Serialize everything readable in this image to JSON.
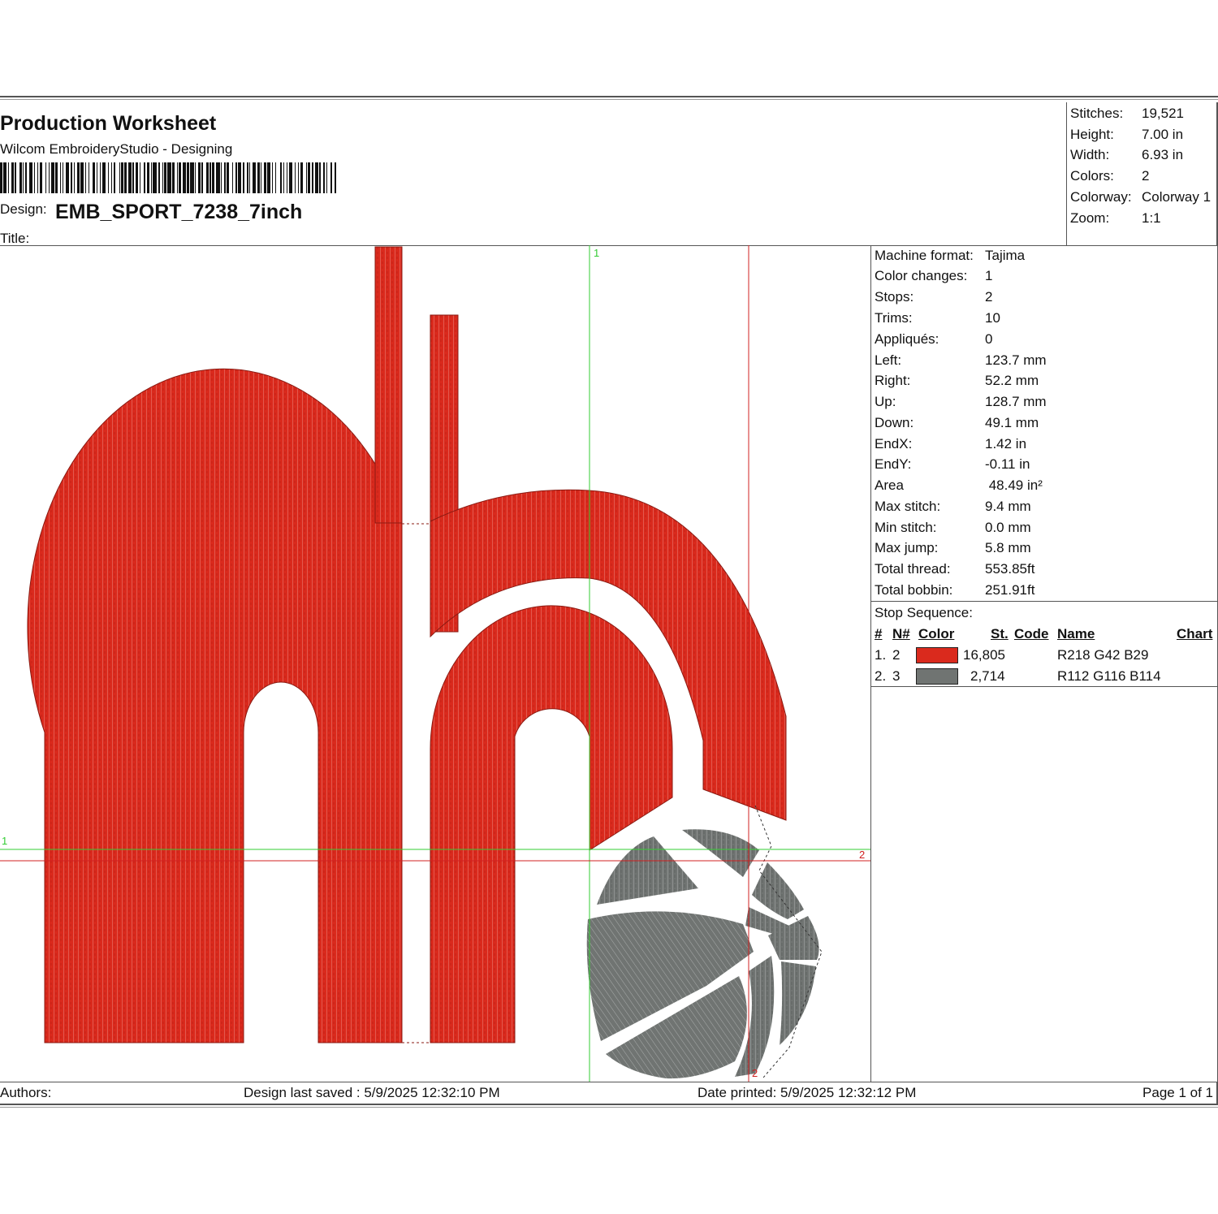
{
  "header": {
    "title": "Production Worksheet",
    "subtitle": "Wilcom EmbroideryStudio - Designing",
    "design_label": "Design:",
    "design_value": "EMB_SPORT_7238_7inch",
    "title_label": "Title:"
  },
  "summary": [
    {
      "label": "Stitches:",
      "value": "19,521"
    },
    {
      "label": "Height:",
      "value": "7.00 in"
    },
    {
      "label": "Width:",
      "value": "6.93 in"
    },
    {
      "label": "Colors:",
      "value": "2"
    },
    {
      "label": "Colorway:",
      "value": "Colorway 1"
    },
    {
      "label": "Zoom:",
      "value": "1:1"
    }
  ],
  "machine_info": [
    {
      "label": "Machine format:",
      "value": "Tajima"
    },
    {
      "label": "Color changes:",
      "value": "1"
    },
    {
      "label": "Stops:",
      "value": "2"
    },
    {
      "label": "Trims:",
      "value": "10"
    },
    {
      "label": "Appliqués:",
      "value": "0"
    },
    {
      "label": "Left:",
      "value": "123.7 mm"
    },
    {
      "label": "Right:",
      "value": "52.2 mm"
    },
    {
      "label": "Up:",
      "value": "128.7 mm"
    },
    {
      "label": "Down:",
      "value": "49.1 mm"
    },
    {
      "label": "EndX:",
      "value": "1.42 in"
    },
    {
      "label": "EndY:",
      "value": "-0.11 in"
    },
    {
      "label": "Area",
      "value": " 48.49 in²"
    },
    {
      "label": "Max stitch:",
      "value": "9.4 mm"
    },
    {
      "label": "Min stitch:",
      "value": "0.0 mm"
    },
    {
      "label": "Max jump:",
      "value": "5.8 mm"
    },
    {
      "label": "Total thread:",
      "value": "553.85ft"
    },
    {
      "label": "Total bobbin:",
      "value": "251.91ft"
    }
  ],
  "stop_sequence": {
    "title": "Stop Sequence:",
    "headers": {
      "num": "#",
      "needle": "N#",
      "color": "Color",
      "stitches": "St.",
      "code": "Code",
      "name": "Name",
      "chart": "Chart"
    },
    "rows": [
      {
        "num": "1.",
        "needle": "2",
        "color": "#DA2A1D",
        "stitches": "16,805",
        "code": "",
        "name": "R218 G42 B29",
        "chart": ""
      },
      {
        "num": "2.",
        "needle": "3",
        "color": "#707472",
        "stitches": "2,714",
        "code": "",
        "name": "R112 G116 B114",
        "chart": ""
      }
    ]
  },
  "canvas": {
    "guide_labels": {
      "green_v": "1",
      "green_h": "1",
      "red_h": "2",
      "red_v": "2"
    },
    "colors": {
      "thread_red": "#DA2A1D",
      "thread_gray": "#707472",
      "guide_green": "#33cc33",
      "guide_red": "#d02020"
    }
  },
  "footer": {
    "authors": "Authors:",
    "saved": "Design last saved : 5/9/2025 12:32:10 PM",
    "printed": "Date printed: 5/9/2025 12:32:12 PM",
    "page": "Page 1 of 1"
  }
}
